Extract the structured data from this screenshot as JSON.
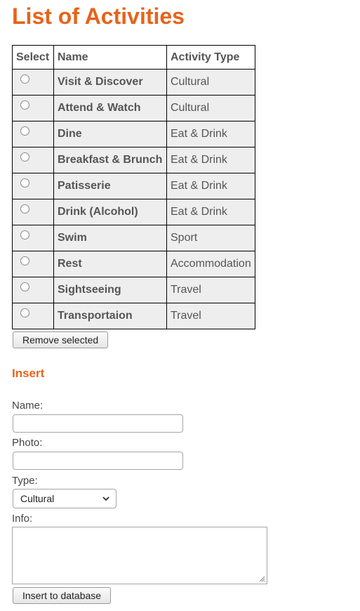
{
  "page": {
    "title": "List of Activities"
  },
  "table": {
    "headers": {
      "select": "Select",
      "name": "Name",
      "type": "Activity Type"
    },
    "rows": [
      {
        "name": "Visit & Discover",
        "type": "Cultural"
      },
      {
        "name": "Attend & Watch",
        "type": "Cultural"
      },
      {
        "name": "Dine",
        "type": "Eat & Drink"
      },
      {
        "name": "Breakfast & Brunch",
        "type": "Eat & Drink"
      },
      {
        "name": "Patisserie",
        "type": "Eat & Drink"
      },
      {
        "name": "Drink (Alcohol)",
        "type": "Eat & Drink"
      },
      {
        "name": "Swim",
        "type": "Sport"
      },
      {
        "name": "Rest",
        "type": "Accommodation"
      },
      {
        "name": "Sightseeing",
        "type": "Travel"
      },
      {
        "name": "Transportaion",
        "type": "Travel"
      }
    ]
  },
  "buttons": {
    "remove_selected": "Remove selected",
    "insert": "Insert to database"
  },
  "insert_form": {
    "title": "Insert",
    "name_label": "Name:",
    "name_value": "",
    "photo_label": "Photo:",
    "photo_value": "",
    "type_label": "Type:",
    "type_selected": "Cultural",
    "info_label": "Info:",
    "info_value": ""
  },
  "colors": {
    "accent": "#e8631a",
    "row_background": "#eeeeee"
  }
}
